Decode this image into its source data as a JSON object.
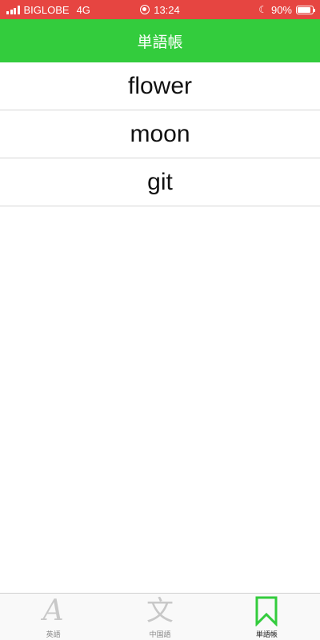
{
  "status_bar": {
    "carrier": "BIGLOBE",
    "network": "4G",
    "time": "13:24",
    "battery": "90%",
    "battery_level": 0.9
  },
  "nav": {
    "title": "単語帳"
  },
  "words": [
    {
      "text": "flower"
    },
    {
      "text": "moon"
    },
    {
      "text": "git"
    }
  ],
  "tab_bar": {
    "tabs": [
      {
        "label": "英語",
        "icon": "letter-a-icon",
        "glyph": "A",
        "active": false
      },
      {
        "label": "中国語",
        "icon": "chinese-character-icon",
        "glyph": "文",
        "active": false
      },
      {
        "label": "単語帳",
        "icon": "bookmark-icon",
        "active": true
      }
    ]
  },
  "colors": {
    "status_bar": "#e64541",
    "nav_bar": "#33cc3d",
    "active_tab": "#33cc3d",
    "inactive_tab": "#c8c8c8"
  }
}
